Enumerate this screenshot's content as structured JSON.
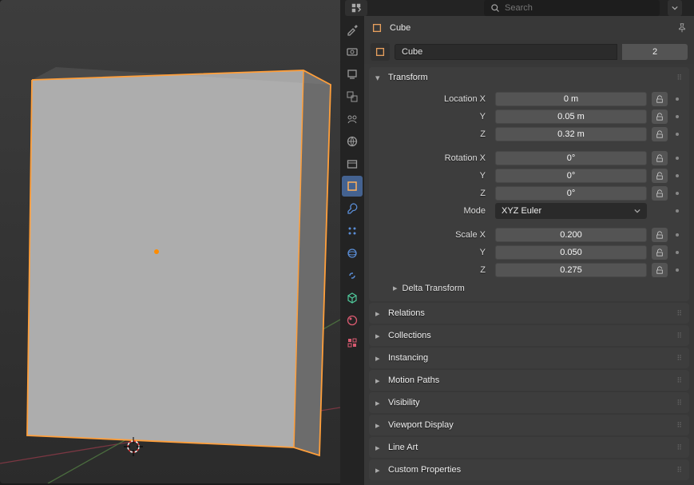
{
  "viewport": {
    "object_name": "Cube"
  },
  "search": {
    "placeholder": "Search"
  },
  "breadcrumb": {
    "object": "Cube"
  },
  "datablock": {
    "name": "Cube",
    "users": "2"
  },
  "transform": {
    "title": "Transform",
    "location": {
      "label_x": "Location X",
      "label_y": "Y",
      "label_z": "Z",
      "x": "0 m",
      "y": "0.05 m",
      "z": "0.32 m"
    },
    "rotation": {
      "label_x": "Rotation X",
      "label_y": "Y",
      "label_z": "Z",
      "x": "0°",
      "y": "0°",
      "z": "0°"
    },
    "mode": {
      "label": "Mode",
      "value": "XYZ Euler"
    },
    "scale": {
      "label_x": "Scale X",
      "label_y": "Y",
      "label_z": "Z",
      "x": "0.200",
      "y": "0.050",
      "z": "0.275"
    },
    "delta": "Delta Transform"
  },
  "panels": {
    "relations": "Relations",
    "collections": "Collections",
    "instancing": "Instancing",
    "motion_paths": "Motion Paths",
    "visibility": "Visibility",
    "viewport_display": "Viewport Display",
    "line_art": "Line Art",
    "custom_properties": "Custom Properties"
  },
  "tabs": [
    "tool-icon",
    "render-icon",
    "output-icon",
    "viewlayer-icon",
    "scene-icon",
    "world-icon",
    "collection-icon",
    "object-icon",
    "modifier-icon",
    "particle-icon",
    "physics-icon",
    "constraint-icon",
    "mesh-icon",
    "material-icon",
    "texture-icon"
  ]
}
